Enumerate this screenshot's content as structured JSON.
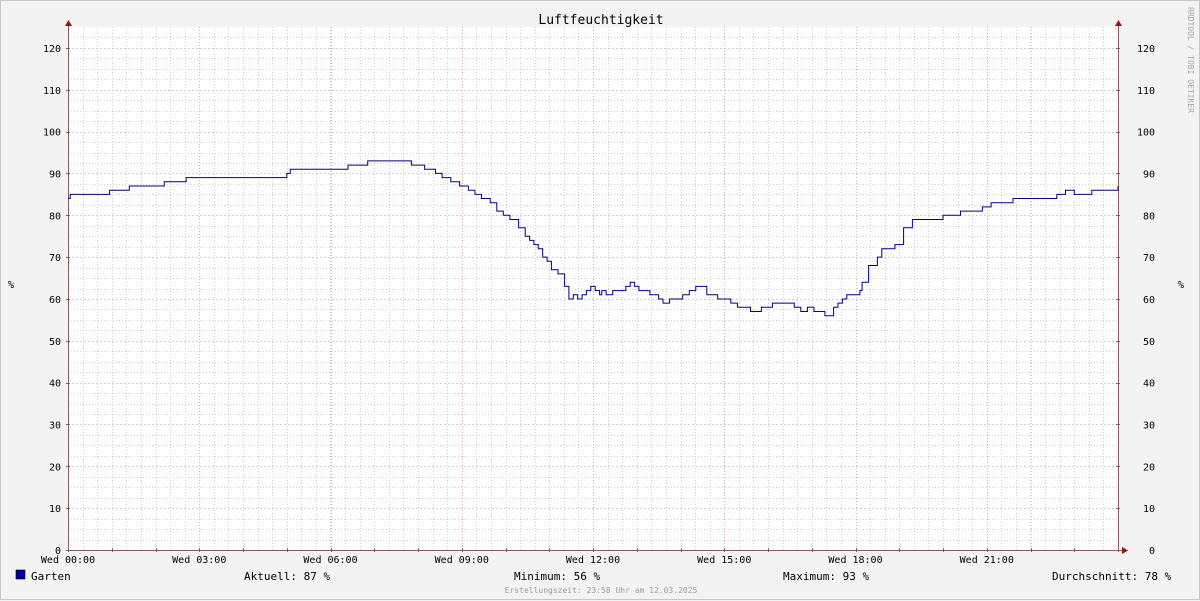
{
  "chart_data": {
    "type": "line",
    "title": "Luftfeuchtigkeit",
    "ylabel": "%",
    "ylim": [
      0,
      125
    ],
    "yticks": [
      0,
      10,
      20,
      30,
      40,
      50,
      60,
      70,
      80,
      90,
      100,
      110,
      120
    ],
    "xlim": [
      0,
      24
    ],
    "xticks": [
      {
        "hour": 0,
        "label": "Wed 00:00"
      },
      {
        "hour": 3,
        "label": "Wed 03:00"
      },
      {
        "hour": 6,
        "label": "Wed 06:00"
      },
      {
        "hour": 9,
        "label": "Wed 09:00"
      },
      {
        "hour": 12,
        "label": "Wed 12:00"
      },
      {
        "hour": 15,
        "label": "Wed 15:00"
      },
      {
        "hour": 18,
        "label": "Wed 18:00"
      },
      {
        "hour": 21,
        "label": "Wed 21:00"
      }
    ],
    "grid": true,
    "series": [
      {
        "name": "Garten",
        "color": "#00007f",
        "hours": [
          0,
          0.05,
          0.5,
          0.95,
          1.4,
          2.2,
          2.7,
          4.3,
          5.0,
          5.08,
          5.2,
          6.4,
          6.85,
          7.85,
          8.15,
          8.4,
          8.55,
          8.75,
          8.95,
          9.15,
          9.3,
          9.45,
          9.65,
          9.8,
          9.95,
          10.1,
          10.3,
          10.45,
          10.55,
          10.65,
          10.75,
          10.85,
          10.95,
          11.05,
          11.2,
          11.35,
          11.45,
          11.55,
          11.65,
          11.75,
          11.85,
          11.95,
          12.05,
          12.15,
          12.2,
          12.3,
          12.45,
          12.55,
          12.65,
          12.75,
          12.85,
          12.95,
          13.05,
          13.3,
          13.5,
          13.6,
          13.75,
          13.9,
          14.05,
          14.2,
          14.35,
          14.45,
          14.6,
          14.85,
          15.0,
          15.15,
          15.3,
          15.6,
          15.85,
          16.1,
          16.3,
          16.6,
          16.75,
          16.9,
          17.05,
          17.2,
          17.3,
          17.5,
          17.6,
          17.7,
          17.8,
          18.0,
          18.1,
          18.15,
          18.3,
          18.5,
          18.6,
          18.7,
          18.9,
          19.1,
          19.3,
          19.6,
          20.0,
          20.4,
          20.9,
          21.1,
          21.6,
          22.0,
          22.6,
          22.8,
          23.0,
          23.4,
          24.0
        ],
        "values": [
          84,
          85,
          85,
          86,
          87,
          88,
          89,
          89,
          90,
          91,
          91,
          92,
          93,
          92,
          91,
          90,
          89,
          88,
          87,
          86,
          85,
          84,
          83,
          81,
          80,
          79,
          77,
          75,
          74,
          73,
          72,
          70,
          69,
          67,
          66,
          63,
          60,
          61,
          60,
          61,
          62,
          63,
          62,
          61,
          62,
          61,
          62,
          62,
          62,
          63,
          64,
          63,
          62,
          61,
          60,
          59,
          60,
          60,
          61,
          62,
          63,
          63,
          61,
          60,
          60,
          59,
          58,
          57,
          58,
          59,
          59,
          58,
          57,
          58,
          57,
          57,
          56,
          58,
          59,
          60,
          61,
          61,
          62,
          64,
          68,
          70,
          72,
          72,
          73,
          77,
          79,
          79,
          80,
          81,
          82,
          83,
          84,
          84,
          85,
          86,
          85,
          86,
          87
        ]
      }
    ],
    "legend": {
      "placement": "bottom-left",
      "label": "Garten",
      "color": "#0000a0"
    },
    "stats": [
      {
        "label": "Aktuell:",
        "value": "87 %"
      },
      {
        "label": "Minimum:",
        "value": "56 %"
      },
      {
        "label": "Maximum:",
        "value": "93 %"
      },
      {
        "label": "Durchschnitt:",
        "value": "78 %"
      }
    ],
    "footer": "Erstellungszeit: 23:58 Uhr am 12.03.2025",
    "watermark": "RRDTOOL / TOBI OETIKER",
    "colors": {
      "background": "#f3f3f3",
      "plot_background": "#ffffff",
      "major_grid": "#e6a8a8",
      "minor_grid": "#cfcfcf",
      "axis": "#8b5a5a",
      "arrow": "#8b1a1a"
    }
  }
}
